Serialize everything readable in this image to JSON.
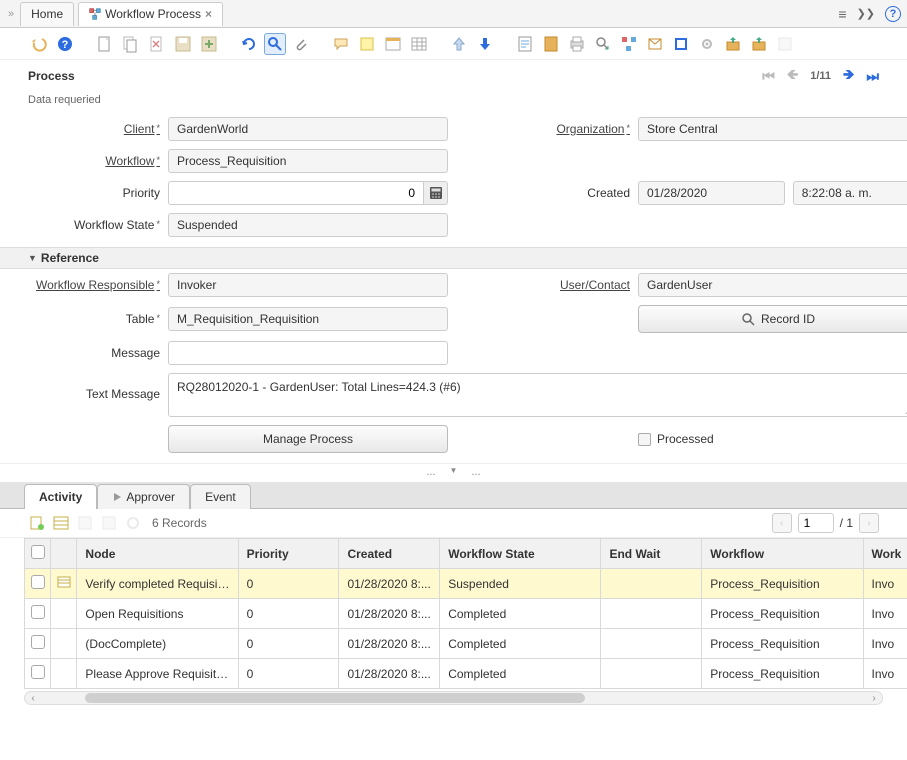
{
  "tabs": {
    "home": "Home",
    "workflow": "Workflow Process"
  },
  "top_icons": {
    "hamburger": "≡",
    "chevrons": "❯❯",
    "help": "?"
  },
  "section": {
    "title": "Process",
    "status": "Data requeried",
    "position": "1/11"
  },
  "form": {
    "client_label": "Client",
    "client_value": "GardenWorld",
    "organization_label": "Organization",
    "organization_value": "Store Central",
    "workflow_label": "Workflow",
    "workflow_value": "Process_Requisition",
    "priority_label": "Priority",
    "priority_value": "0",
    "created_label": "Created",
    "created_date": "01/28/2020",
    "created_time": "8:22:08 a. m.",
    "workflow_state_label": "Workflow State",
    "workflow_state_value": "Suspended"
  },
  "reference": {
    "title": "Reference",
    "wf_responsible_label": "Workflow Responsible",
    "wf_responsible_value": "Invoker",
    "user_contact_label": "User/Contact",
    "user_contact_value": "GardenUser",
    "table_label": "Table",
    "table_value": "M_Requisition_Requisition",
    "record_id_btn": "Record ID",
    "message_label": "Message",
    "text_message_label": "Text Message",
    "text_message_value": "RQ28012020-1 - GardenUser: Total Lines=424.3 (#6)",
    "manage_process_btn": "Manage Process",
    "processed_label": "Processed"
  },
  "bottom_tabs": {
    "activity": "Activity",
    "approver": "Approver",
    "event": "Event"
  },
  "grid_toolbar": {
    "records": "6 Records",
    "page_value": "1",
    "page_total": "/ 1"
  },
  "grid": {
    "columns": [
      "",
      "",
      "Node",
      "Priority",
      "Created",
      "Workflow State",
      "End Wait",
      "Workflow",
      "Work"
    ],
    "rows": [
      {
        "node": "Verify completed Requisition",
        "priority": "0",
        "created": "01/28/2020 8:...",
        "state": "Suspended",
        "endwait": "",
        "workflow": "Process_Requisition",
        "wfr": "Invo",
        "hl": true
      },
      {
        "node": "Open Requisitions",
        "priority": "0",
        "created": "01/28/2020 8:...",
        "state": "Completed",
        "endwait": "",
        "workflow": "Process_Requisition",
        "wfr": "Invo",
        "hl": false
      },
      {
        "node": "(DocComplete)",
        "priority": "0",
        "created": "01/28/2020 8:...",
        "state": "Completed",
        "endwait": "",
        "workflow": "Process_Requisition",
        "wfr": "Invo",
        "hl": false
      },
      {
        "node": "Please Approve Requisition",
        "priority": "0",
        "created": "01/28/2020 8:...",
        "state": "Completed",
        "endwait": "",
        "workflow": "Process_Requisition",
        "wfr": "Invo",
        "hl": false
      }
    ]
  },
  "midbar": {
    "dots": "..."
  }
}
